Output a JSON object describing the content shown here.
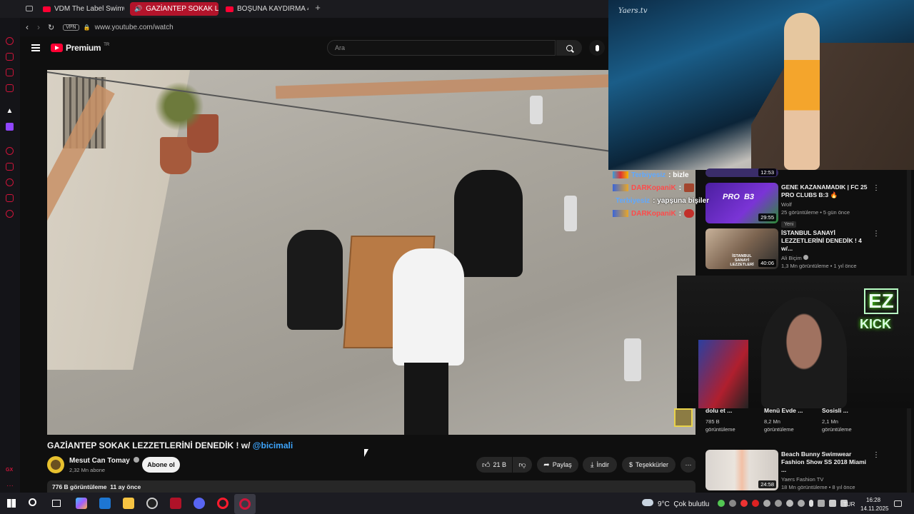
{
  "browser": {
    "tabs": [
      {
        "label": "VDM The Label Swimwea"
      },
      {
        "label": "GAZİANTEP SOKAK L"
      },
      {
        "label": "BOŞUNA KAYDIRMA 44/"
      }
    ],
    "vpn_label": "VPN",
    "url": "www.youtube.com/watch"
  },
  "youtube": {
    "logo_text": "Premium",
    "logo_badge": "TR",
    "search_placeholder": "Ara"
  },
  "video": {
    "title_main": "GAZİANTEP SOKAK LEZZETLERİNİ DENEDİK ! w/ ",
    "title_mention": "@bicimali",
    "channel_name": "Mesut Can Tomay",
    "subscribers": "2,32 Mn abone",
    "subscribe_label": "Abone ol",
    "likes": "21 B",
    "share_label": "Paylaş",
    "download_label": "İndir",
    "thanks_label": "Teşekkürler",
    "description_meta": "776 B görüntüleme  11 ay önce"
  },
  "recommendations": {
    "top_duration": "12:53",
    "items": [
      {
        "title": "GENE KAZANAMADIK | FC 25 PRO CLUBS B:3 🔥",
        "channel": "Wolf",
        "meta": "25 görüntüleme • 5 gün önce",
        "badge": "Yeni",
        "duration": "29:55",
        "thumb_text": "PRO  B3"
      },
      {
        "title": "İSTANBUL SANAYİ LEZZETLERİNİ DENEDİK ! 4 w/...",
        "channel": "Ali Biçim",
        "meta": "1,3 Mn görüntüleme • 1 yıl önce",
        "duration": "40:06",
        "thumb_text": "İSTANBUL SANAYİ LEZZETLERİ"
      },
      {
        "title": "Beach Bunny Swimwear Fashion Show SS 2018 Miami ...",
        "channel": "Yaers Fashion TV",
        "meta": "18 Mn görüntüleme • 8 yıl önce",
        "duration": "24:58"
      }
    ],
    "shorts": [
      {
        "title": "dolu et ...",
        "views": "785 B",
        "views_label": "görüntüleme"
      },
      {
        "title": "Menü Evde ...",
        "views": "8,2 Mn",
        "views_label": "görüntüleme"
      },
      {
        "title": "Sosisli ...",
        "views": "2,1 Mn",
        "views_label": "görüntüleme"
      }
    ]
  },
  "stream": {
    "chat": [
      {
        "user": "Terbiyesiz",
        "message": ": bizle",
        "color": "#5fa8ff"
      },
      {
        "user": "DARKopaniK",
        "message": ":",
        "color": "#ff4a4a"
      },
      {
        "user": "Terbiyesiz",
        "message": ": yapşuna bişiler",
        "color": "#5fa8ff"
      },
      {
        "user": "DARKopaniK",
        "message": ":",
        "color": "#ff4a4a"
      }
    ],
    "overlay_logo_top": "EZ",
    "overlay_logo_bottom": "KICK",
    "runway_watermark": "Yaers.tv"
  },
  "taskbar": {
    "weather": "9°C  Çok bulutlu",
    "language": "TUR",
    "time": "16:28",
    "date": "14.11.2025"
  },
  "colors": {
    "accent": "#ff0033",
    "opera_red": "#d0143a",
    "kick_green": "#53fc18"
  }
}
